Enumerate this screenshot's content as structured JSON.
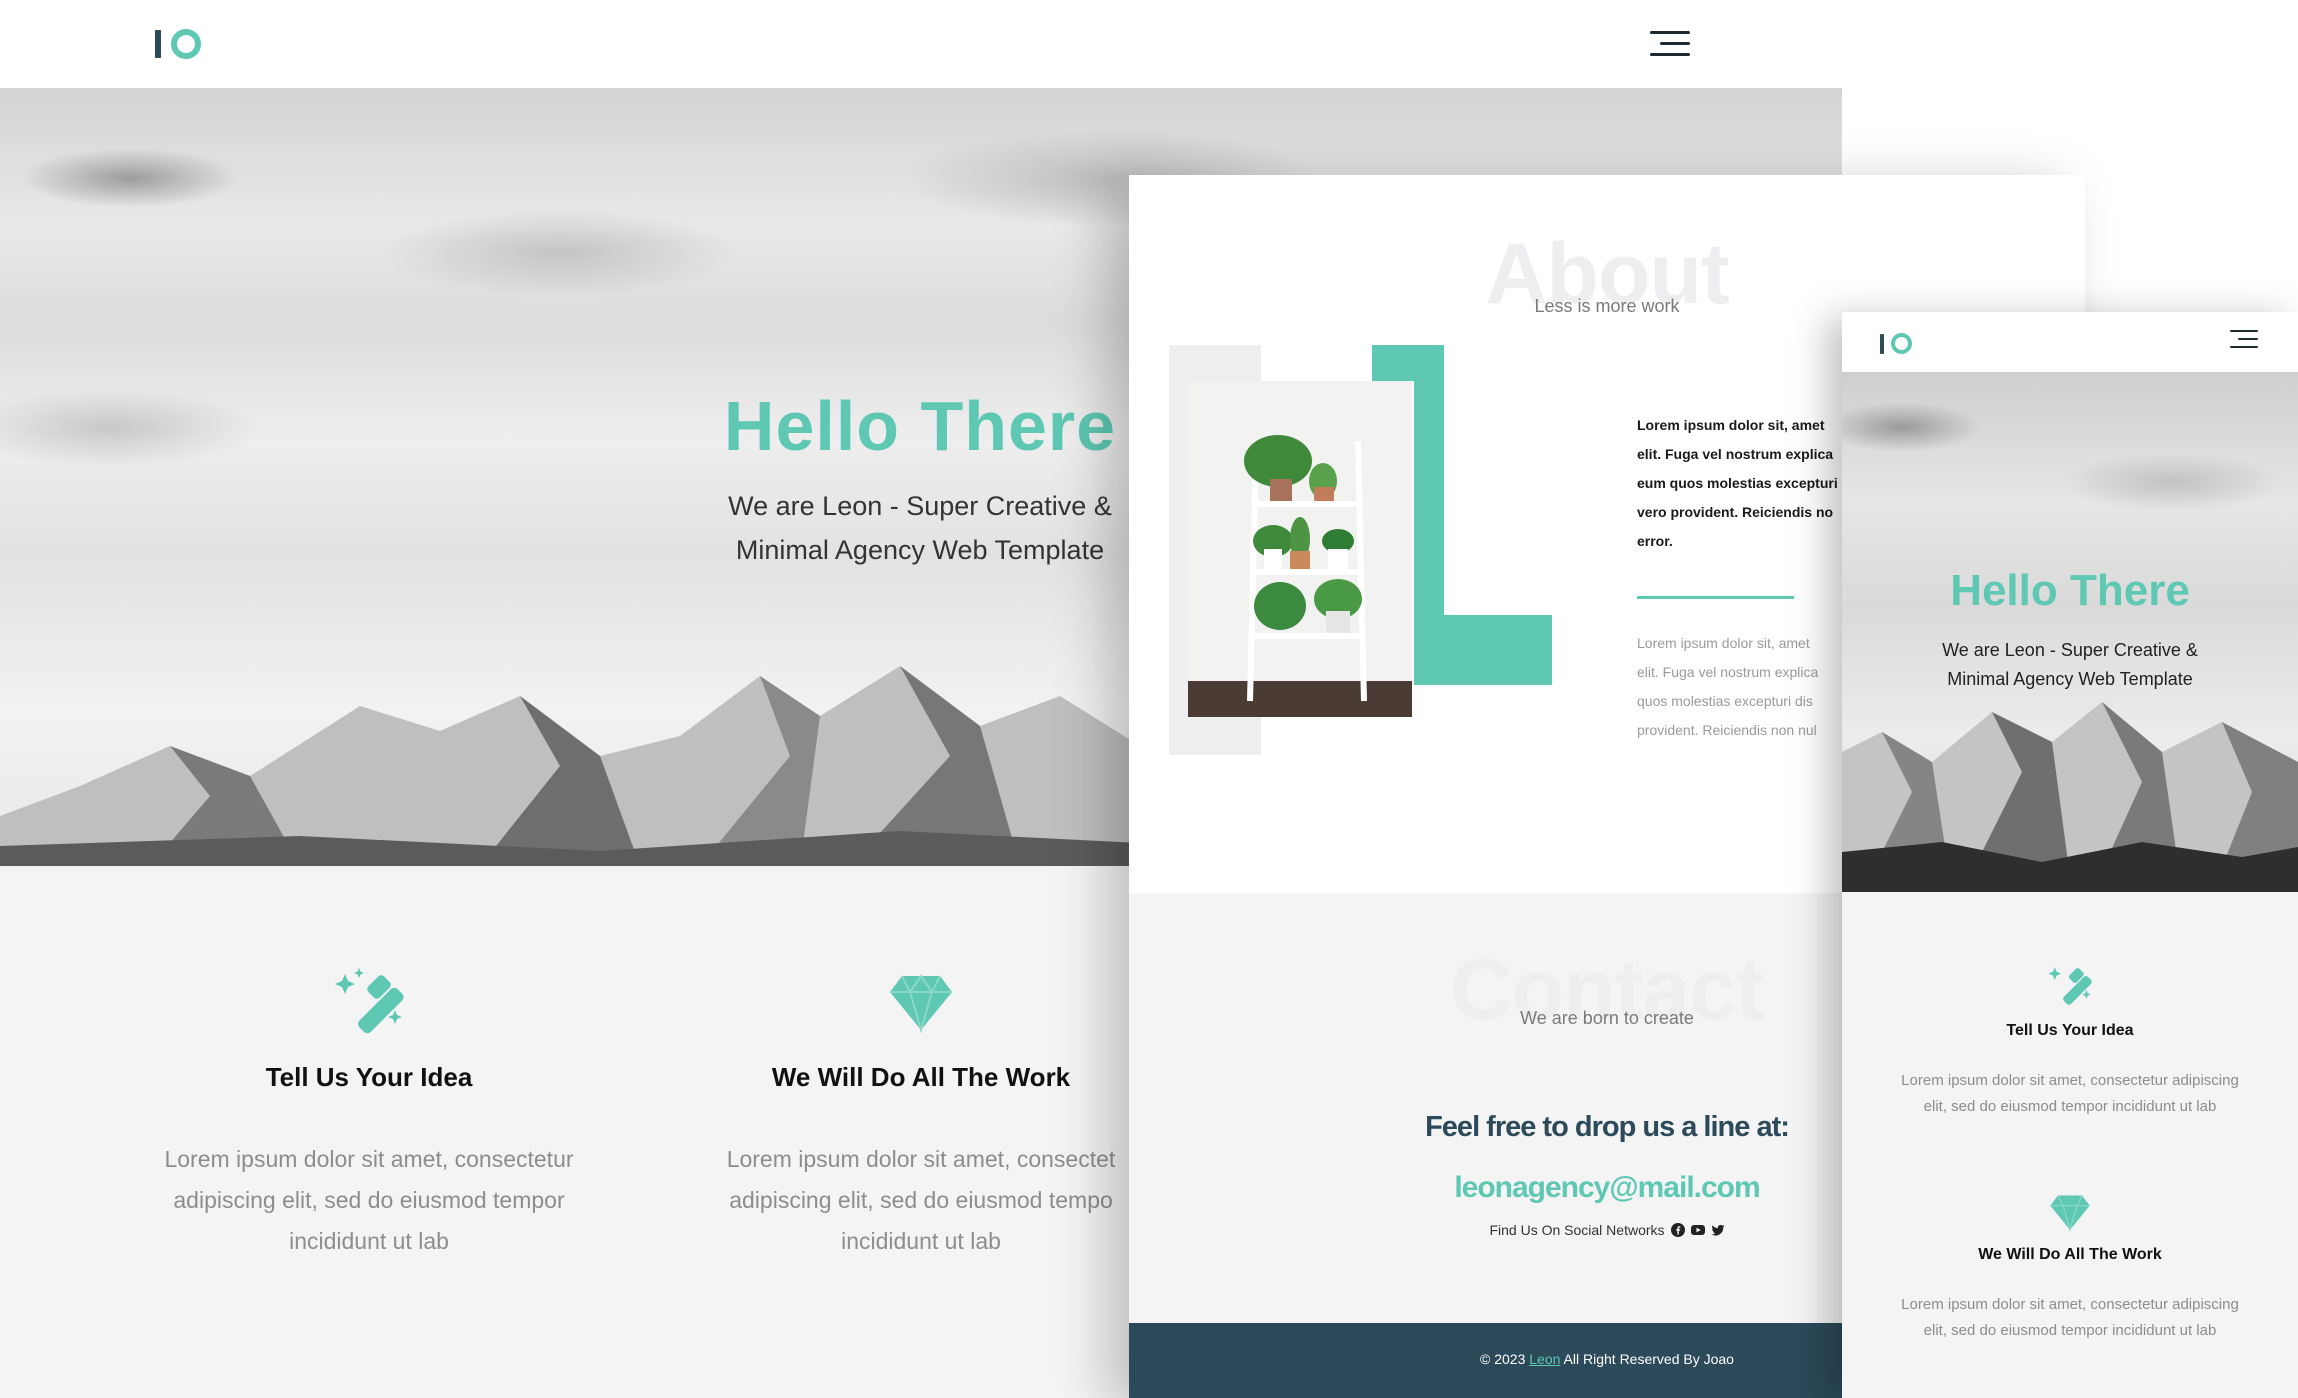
{
  "brand": {
    "logo_text": "IO",
    "accent": "#5ec8b3",
    "dark": "#2c4a5a",
    "light_bg": "#f4f4f4"
  },
  "desktop": {
    "hero": {
      "title": "Hello There",
      "subtitle_line1": "We are Leon - Super Creative &",
      "subtitle_line2": "Minimal Agency Web Template"
    },
    "features": [
      {
        "icon": "magic-wand-icon",
        "title": "Tell Us Your Idea",
        "line1": "Lorem ipsum dolor sit amet, consectetur",
        "line2": "adipiscing elit, sed do eiusmod tempor",
        "line3": "incididunt ut lab"
      },
      {
        "icon": "diamond-icon",
        "title": "We Will Do All The Work",
        "line1": "Lorem ipsum dolor sit amet, consectet",
        "line2": "adipiscing elit, sed do eiusmod tempo",
        "line3": "incididunt ut lab"
      }
    ]
  },
  "tablet": {
    "about": {
      "ghost": "About",
      "subtitle": "Less is more work",
      "bold_lines": [
        "Lorem ipsum dolor sit, amet",
        "elit. Fuga vel nostrum explica",
        "eum quos molestias excepturi",
        "vero provident. Reiciendis no",
        "error."
      ],
      "light_lines": [
        "Lorem ipsum dolor sit, amet",
        "elit. Fuga vel nostrum explica",
        "quos molestias excepturi dis",
        "provident. Reiciendis non nul"
      ]
    },
    "contact": {
      "ghost": "Contact",
      "subtitle": "We are born to create",
      "line": "Feel free to drop us a line at:",
      "email": "leonagency@mail.com",
      "social_label": "Find Us On Social Networks",
      "social_icons": [
        "facebook-icon",
        "youtube-icon",
        "twitter-icon"
      ]
    },
    "footer": {
      "prefix": "© 2023",
      "link": "Leon",
      "suffix": "All Right Reserved By Joao"
    }
  },
  "mobile": {
    "hero": {
      "title": "Hello There",
      "subtitle_line1": "We are Leon - Super Creative &",
      "subtitle_line2": "Minimal Agency Web Template"
    },
    "features": [
      {
        "icon": "magic-wand-icon",
        "title": "Tell Us Your Idea",
        "line1": "Lorem ipsum dolor sit amet, consectetur adipiscing",
        "line2": "elit, sed do eiusmod tempor incididunt ut lab"
      },
      {
        "icon": "diamond-icon",
        "title": "We Will Do All The Work",
        "line1": "Lorem ipsum dolor sit amet, consectetur adipiscing",
        "line2": "elit, sed do eiusmod tempor incididunt ut lab"
      }
    ]
  }
}
